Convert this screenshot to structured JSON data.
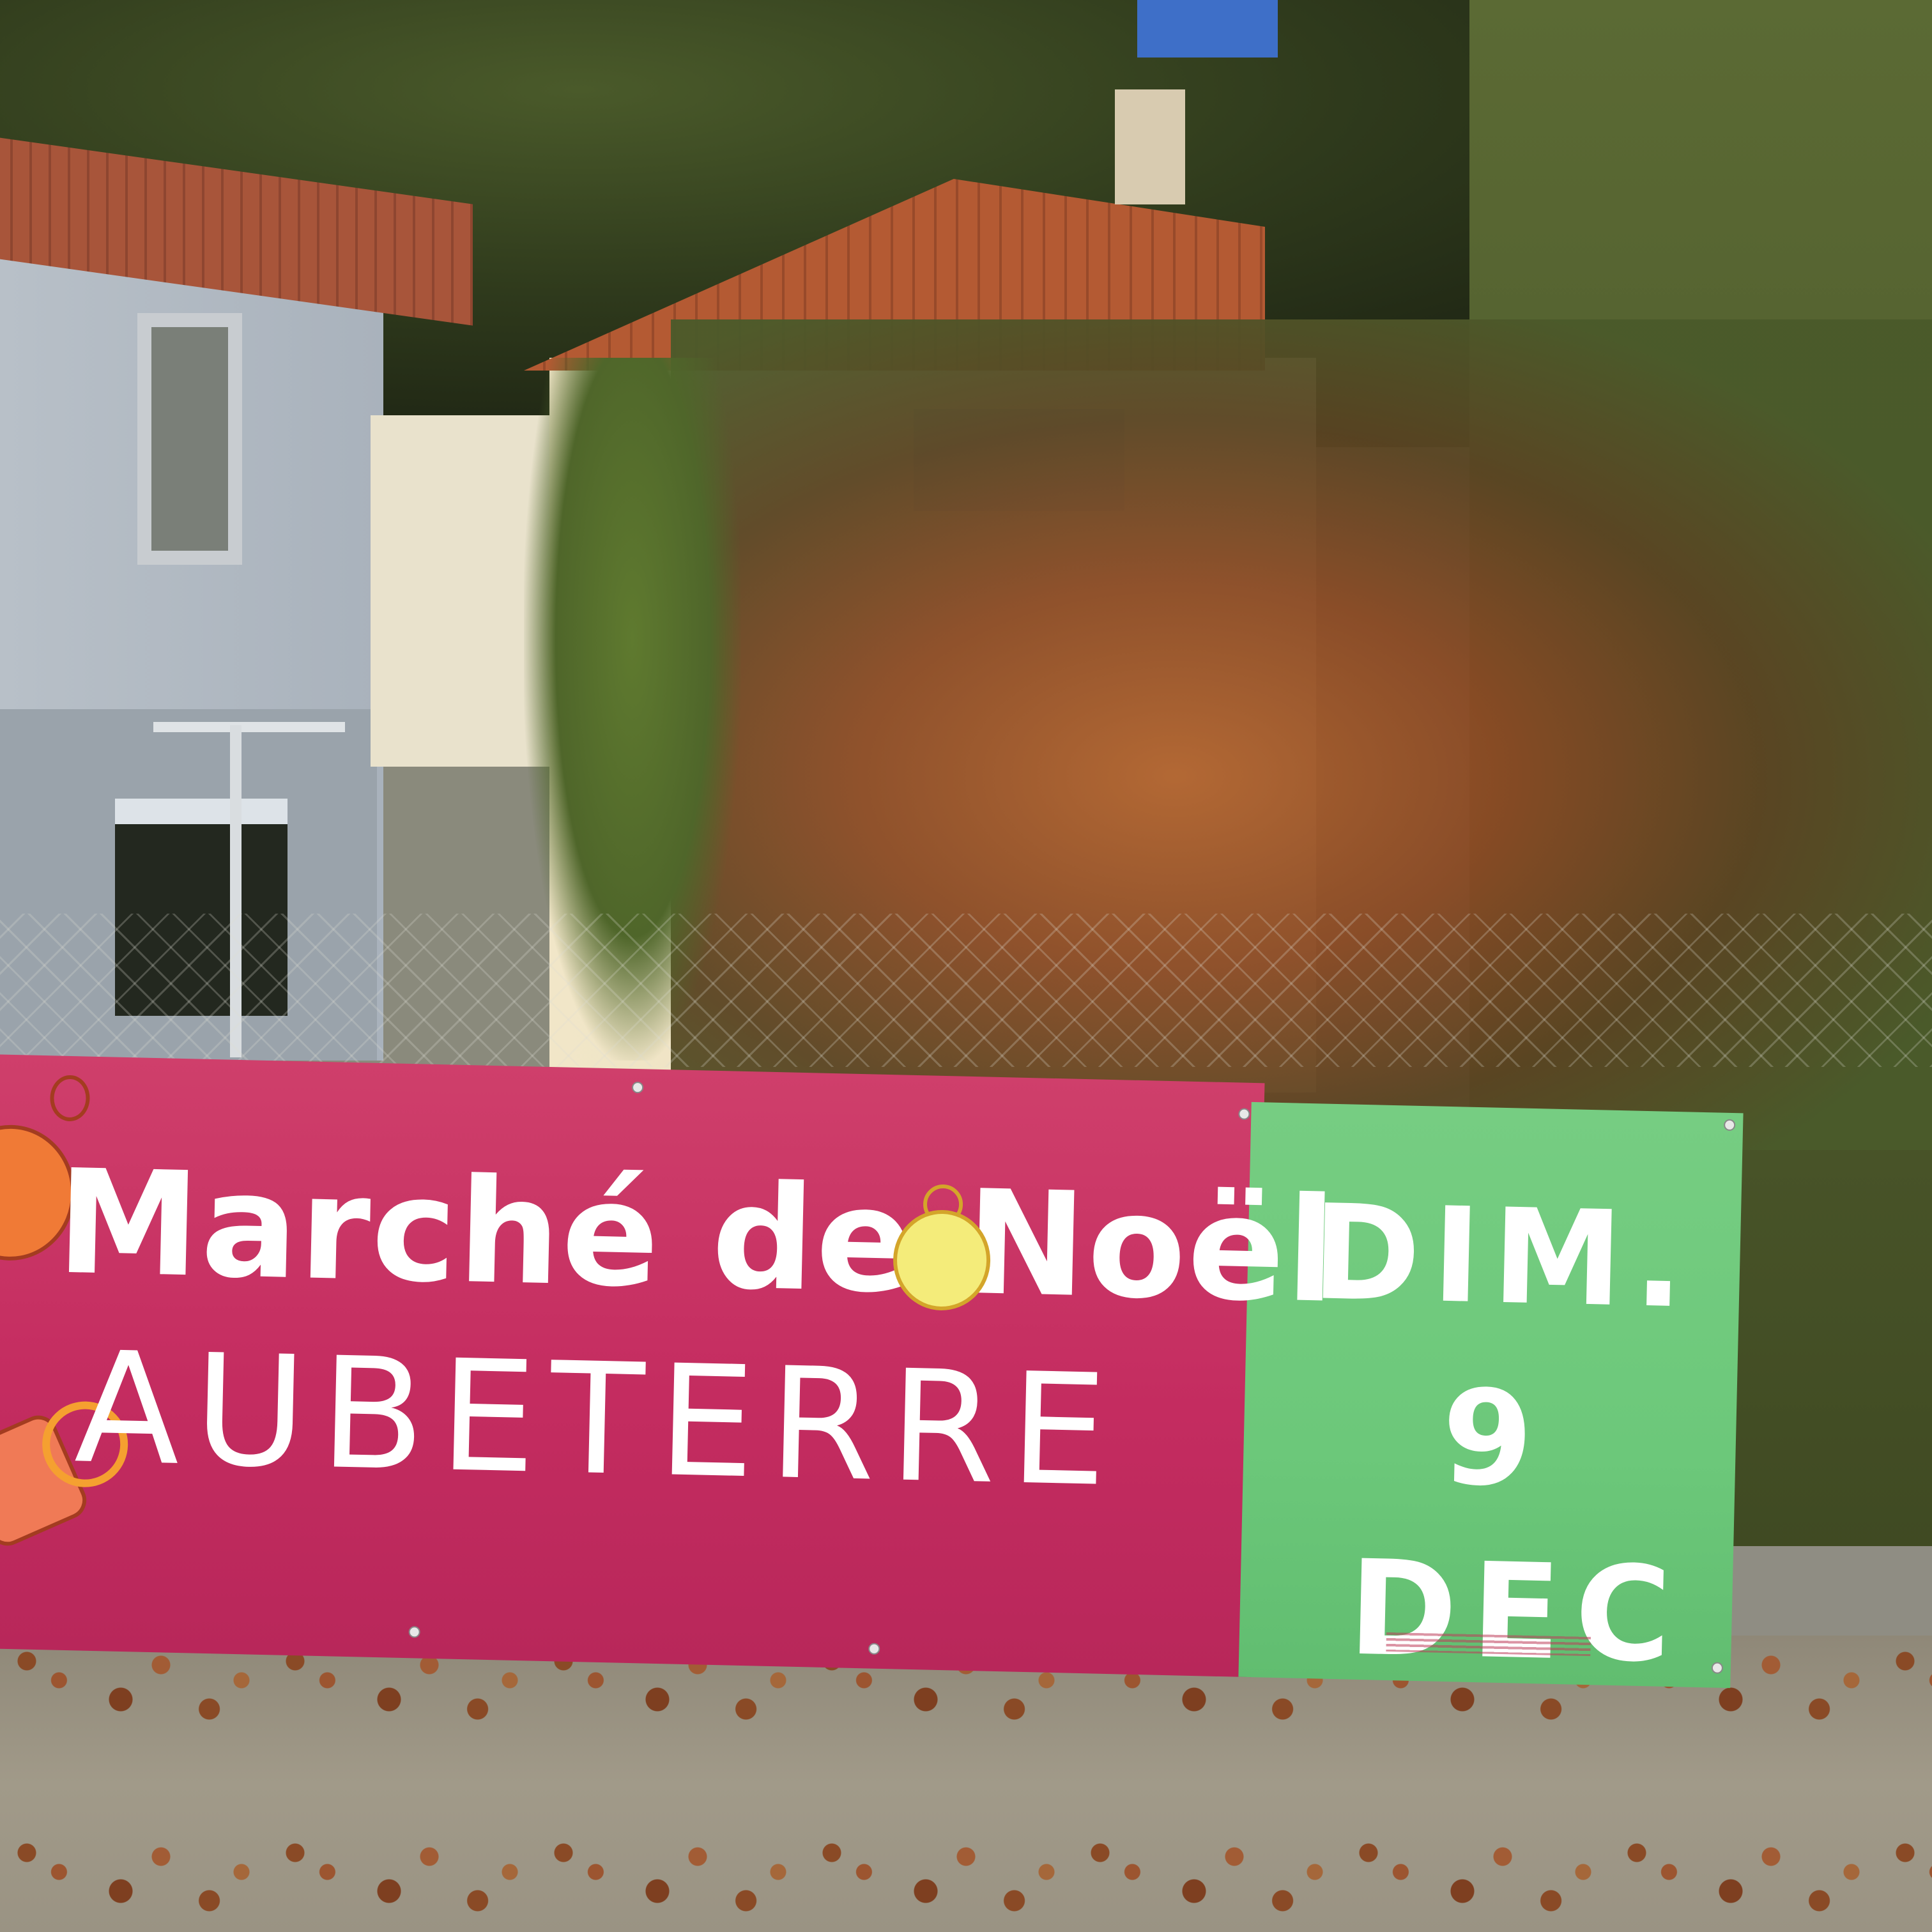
{
  "banner": {
    "title": "Marché de Noël",
    "town": "AUBETERRE",
    "date": {
      "day": "DIM.",
      "number": "9",
      "month": "DEC"
    },
    "colors": {
      "pink_panel": "#c42c60",
      "green_panel": "#6cc87a",
      "text": "#ffffff",
      "ornament_yellow": "#f4ec7a",
      "ornament_orange": "#f07a36"
    }
  }
}
